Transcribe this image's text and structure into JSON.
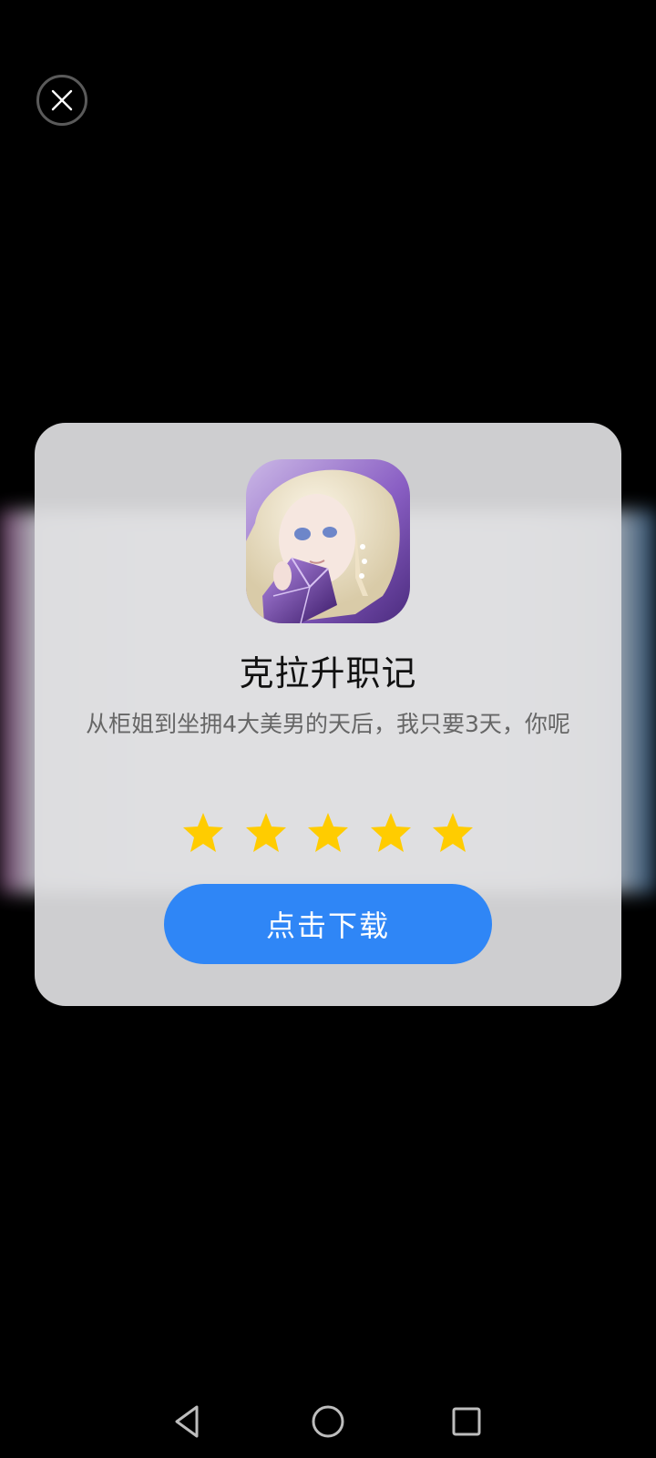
{
  "dialog": {
    "close_icon": "close-icon",
    "app_icon": "app-icon-illustration",
    "app_title": "克拉升职记",
    "description": "从柜姐到坐拥4大美男的天后，我只要3天，你呢",
    "rating": 5,
    "rating_max": 5,
    "download_label": "点击下载"
  },
  "nav": {
    "back_icon": "back-triangle-icon",
    "home_icon": "home-circle-icon",
    "recents_icon": "recents-square-icon"
  },
  "colors": {
    "button": "#2f86f6",
    "star": "#ffcc00",
    "card": "#e0e0e2",
    "background": "#000000"
  }
}
